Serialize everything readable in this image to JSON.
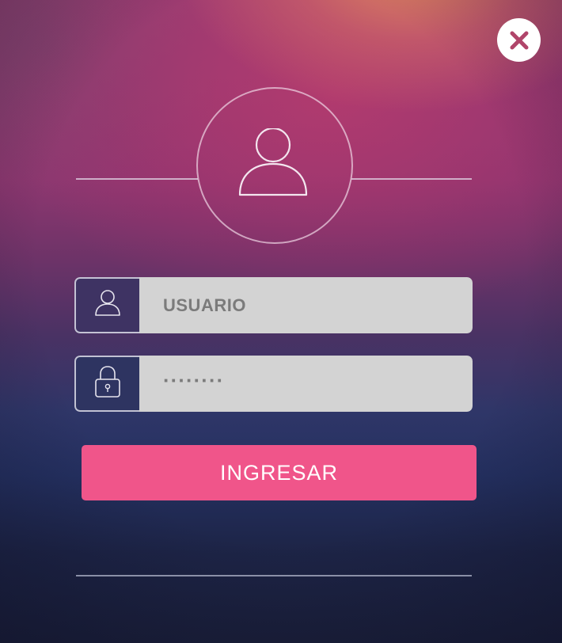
{
  "form": {
    "username_placeholder": "USUARIO",
    "password_value": "········",
    "submit_label": "INGRESAR"
  },
  "icons": {
    "close": "close-icon",
    "avatar": "user-avatar-icon",
    "username": "user-icon",
    "password": "lock-icon"
  },
  "colors": {
    "button": "#f0558a",
    "input_background": "#d3d3d3",
    "input_text": "#7b7b7b",
    "close_icon": "#b0456a"
  }
}
